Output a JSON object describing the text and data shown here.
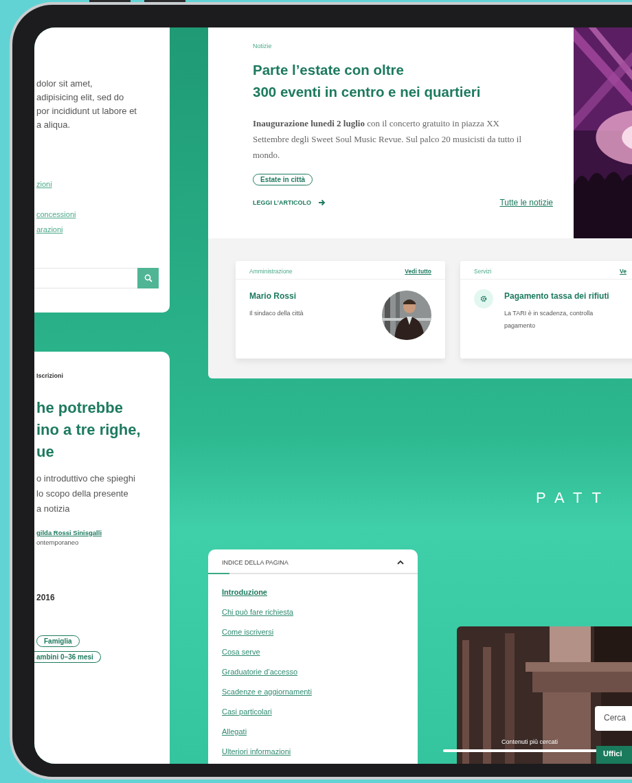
{
  "left_panel": {
    "text_lines": [
      "dolor sit amet,",
      "adipisicing elit, sed do",
      "por incididunt ut labore et",
      "a aliqua."
    ],
    "links": [
      "zioni",
      "concessioni",
      "arazioni"
    ]
  },
  "article_card": {
    "category": "Iscrizioni",
    "title_lines": [
      "he potrebbe",
      "ino a tre righe,",
      "ue"
    ],
    "intro_lines": [
      "o introduttivo che spieghi",
      "lo scopo della presente",
      "a notizia"
    ],
    "author": "gilda Rossi Sinisgalli",
    "author_role": "ontemporaneo",
    "date": "2016",
    "tags": [
      "Famiglia",
      "ambini 0–36 mesi"
    ]
  },
  "news": {
    "category": "Notizie",
    "title_lines": [
      "Parte l’estate con oltre",
      "300 eventi in centro e nei quartieri"
    ],
    "summary": "**Inaugurazione lunedi 2 luglio** con il concerto gratuito in piazza XX Settembre degli Sweet Soul Music Revue. Sul palco 20 musicisti da tutto il mondo.",
    "tag": "Estate in città",
    "read_more": "LEGGI L’ARTICOLO",
    "all_news": "Tutte le notizie"
  },
  "boxes": [
    {
      "kind": "person",
      "section": "Amministrazione",
      "link": "Vedi tutto",
      "name": "Mario Rossi",
      "description_lines": [
        "Il sindaco della città"
      ]
    },
    {
      "kind": "service",
      "section": "Servizi",
      "link": "Ve",
      "name": "Pagamento tassa dei rifiuti",
      "description_lines": [
        "La TARI è in scadenza, controlla",
        "pagamento"
      ]
    }
  ],
  "brand": "PATT",
  "page_index": {
    "title": "INDICE DELLA PAGINA",
    "expanded": true,
    "progress": {
      "level": 0.1
    },
    "items": [
      {
        "label": "Introduzione",
        "selected": true
      },
      {
        "label": "Chi può fare richiesta",
        "selected": false
      },
      {
        "label": "Come iscriversi",
        "selected": false
      },
      {
        "label": "Cosa serve",
        "selected": false
      },
      {
        "label": "Graduatorie d’accesso",
        "selected": false
      },
      {
        "label": "Scadenze e aggiornamenti",
        "selected": false
      },
      {
        "label": "Casi particolari",
        "selected": false
      },
      {
        "label": "Allegati",
        "selected": false
      },
      {
        "label": "Ulteriori informazioni",
        "selected": false
      }
    ]
  },
  "hero": {
    "search_placeholder": "Cerca",
    "caption": "Contenuti più cercati",
    "button": "Uffici"
  }
}
